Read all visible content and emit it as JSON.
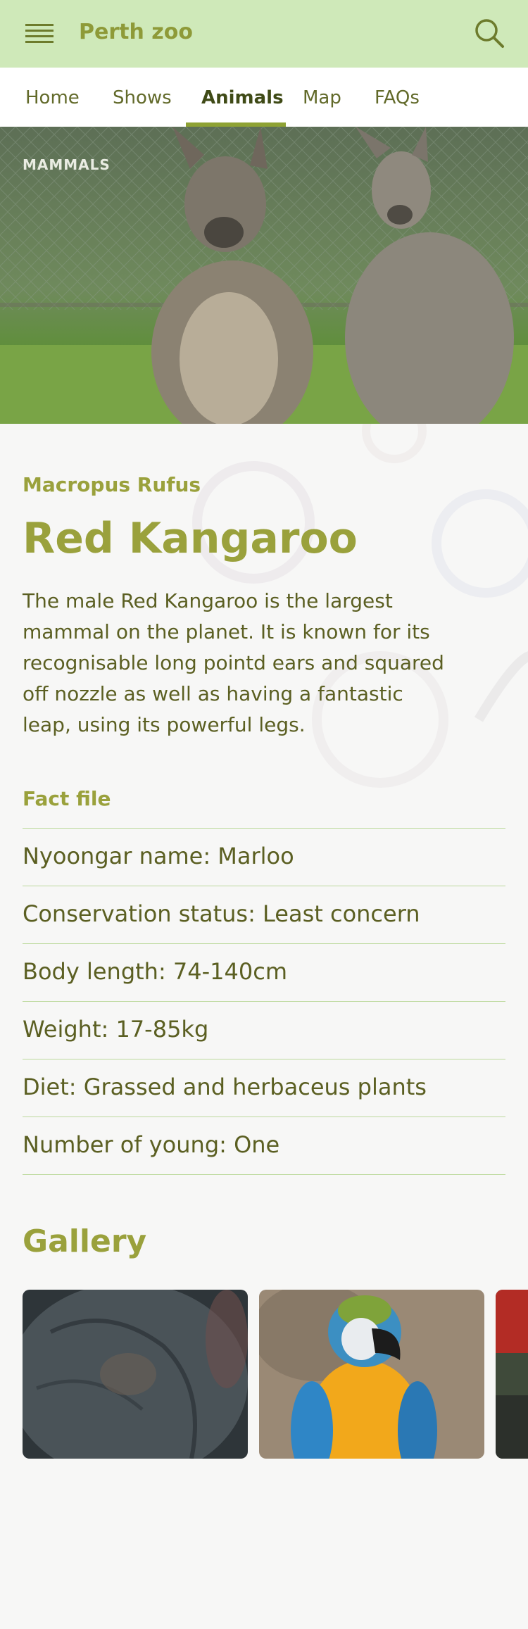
{
  "header": {
    "title": "Perth zoo",
    "menu_icon": "hamburger-menu-icon",
    "search_icon": "search-icon"
  },
  "nav": {
    "tabs": [
      {
        "label": "Home"
      },
      {
        "label": "Shows"
      },
      {
        "label": "Animals",
        "active": true
      },
      {
        "label": "Map"
      },
      {
        "label": "FAQs"
      }
    ]
  },
  "hero": {
    "category": "MAMMALS"
  },
  "animal": {
    "scientific_name": "Macropus Rufus",
    "common_name": "Red Kangaroo",
    "description": "The male Red Kangaroo is the largest mammal on the planet. It is known for its recognisable long pointd ears and squared off nozzle as well as having a fantastic leap, using its powerful legs."
  },
  "fact_file": {
    "title": "Fact file",
    "items": [
      "Nyoongar name: Marloo",
      "Conservation status: Least concern",
      "Body length: 74-140cm",
      "Weight: 17-85kg",
      "Diet: Grassed and herbaceus plants",
      "Number of young: One"
    ]
  },
  "gallery": {
    "title": "Gallery"
  },
  "colors": {
    "header_bg": "#cfe9b9",
    "accent": "#9aa13c",
    "text": "#5b5f22"
  }
}
